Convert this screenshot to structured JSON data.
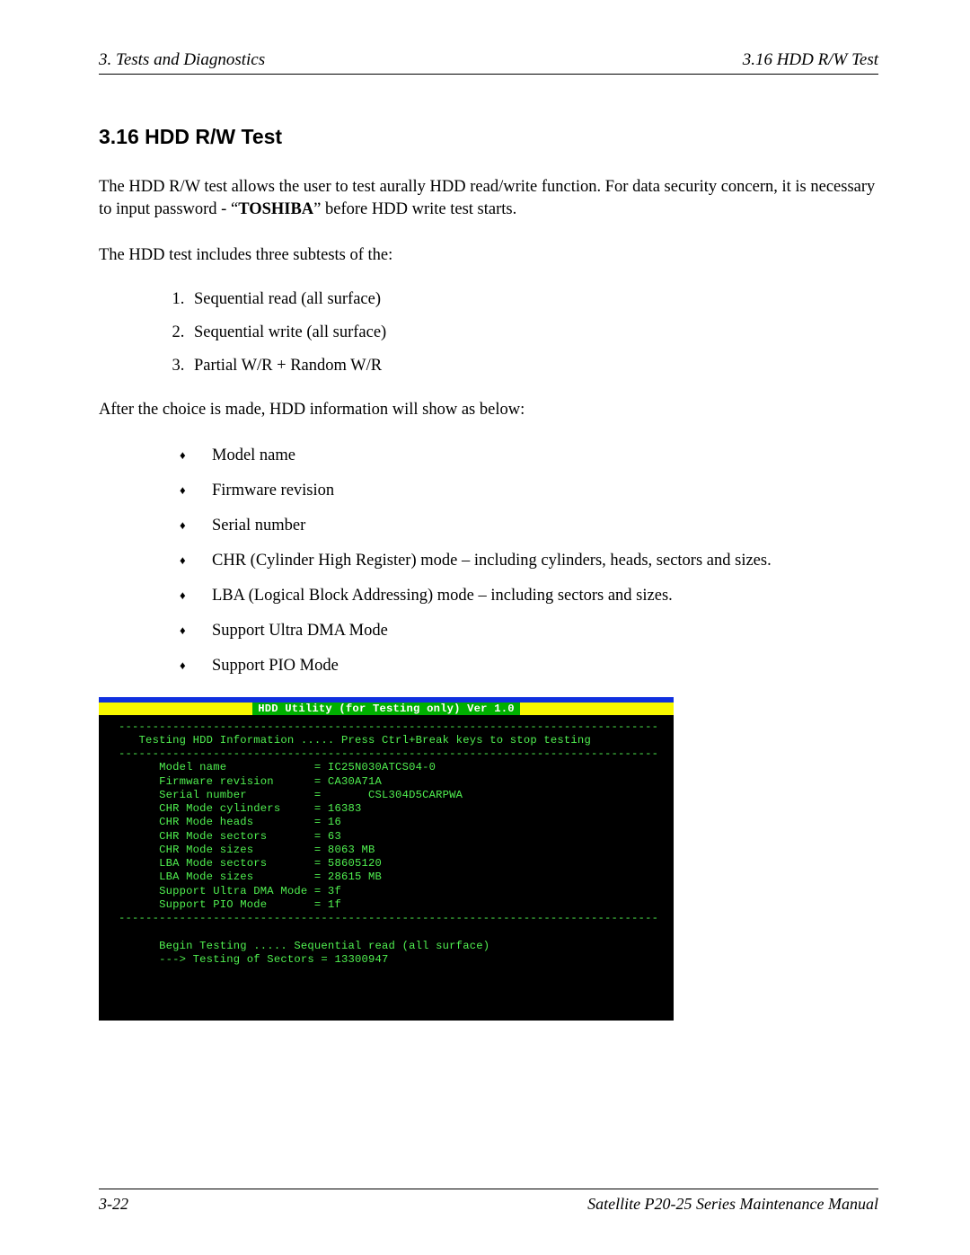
{
  "header": {
    "left": "3.  Tests and Diagnostics",
    "right": "3.16  HDD R/W Test"
  },
  "section_title": "3.16  HDD R/W Test",
  "intro_pre": "The HDD R/W test allows the user to test aurally HDD read/write function. For data security concern, it is necessary to input password - “",
  "intro_bold": "TOSHIBA",
  "intro_post": "” before HDD write test starts.",
  "subtests_lead": "The HDD test includes three subtests of the:",
  "subtests": [
    "Sequential read (all surface)",
    "Sequential write (all surface)",
    "Partial W/R + Random W/R"
  ],
  "info_lead": "After the choice is made, HDD information will show as below:",
  "info_items": [
    "Model name",
    "Firmware revision",
    "Serial number",
    "CHR (Cylinder High Register) mode – including cylinders, heads, sectors and sizes.",
    "LBA (Logical Block Addressing) mode – including sectors and sizes.",
    "Support Ultra DMA Mode",
    "Support PIO Mode"
  ],
  "terminal": {
    "title": "HDD Utility (for Testing only)  Ver 1.0",
    "dash": "--------------------------------------------------------------------------------",
    "heading": "   Testing HDD Information ..... Press Ctrl+Break keys to stop testing",
    "rows": [
      "      Model name             = IC25N030ATCS04-0",
      "      Firmware revision      = CA30A71A",
      "      Serial number          =       CSL304D5CARPWA",
      "      CHR Mode cylinders     = 16383",
      "      CHR Mode heads         = 16",
      "      CHR Mode sectors       = 63",
      "      CHR Mode sizes         = 8063 MB",
      "      LBA Mode sectors       = 58605120",
      "      LBA Mode sizes         = 28615 MB",
      "      Support Ultra DMA Mode = 3f",
      "      Support PIO Mode       = 1f"
    ],
    "begin1": "      Begin Testing ..... Sequential read (all surface)",
    "begin2": "      ---> Testing of Sectors = 13300947"
  },
  "footer": {
    "left": "3-22",
    "right": "Satellite P20-25 Series Maintenance Manual"
  }
}
